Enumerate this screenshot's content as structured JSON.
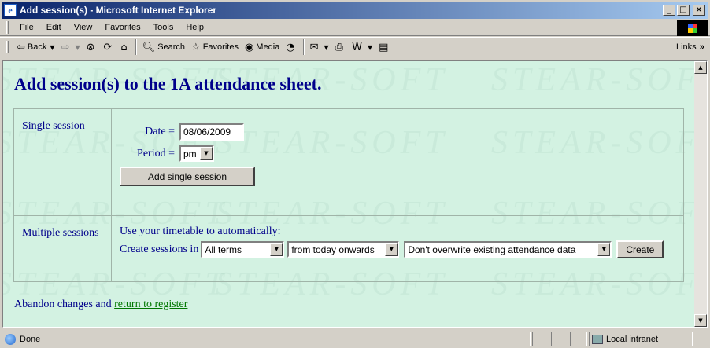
{
  "window": {
    "title": "Add session(s) - Microsoft Internet Explorer",
    "controls": {
      "minimize": "_",
      "maximize": "□",
      "close": "×"
    }
  },
  "menu": {
    "items": [
      {
        "label": "File",
        "accel": "F",
        "rest": "ile"
      },
      {
        "label": "Edit",
        "accel": "E",
        "rest": "dit"
      },
      {
        "label": "View",
        "accel": "V",
        "rest": "iew"
      },
      {
        "label": "Favorites",
        "accel": "F",
        "rest": "avorites",
        "prefix": "F",
        "accel_pos": 0
      },
      {
        "label": "Tools",
        "accel": "T",
        "rest": "ools"
      },
      {
        "label": "Help",
        "accel": "H",
        "rest": "elp"
      }
    ]
  },
  "toolbar": {
    "back_label": "Back",
    "search_label": "Search",
    "favorites_label": "Favorites",
    "media_label": "Media",
    "links_label": "Links",
    "links_chevron": "»"
  },
  "page": {
    "heading": "Add session(s) to the 1A attendance sheet.",
    "watermark_text": "STEAR-SOFT",
    "single": {
      "section_label": "Single session",
      "date_label": "Date =",
      "date_value": "08/06/2009",
      "period_label": "Period =",
      "period_value": "pm",
      "add_button": "Add single session"
    },
    "multiple": {
      "section_label": "Multiple sessions",
      "intro": "Use your timetable to automatically:",
      "create_prefix": "Create sessions in",
      "terms_value": "All terms",
      "range_value": "from today onwards",
      "overwrite_value": "Don't overwrite existing attendance data",
      "create_button": "Create"
    },
    "footer": {
      "prefix": "Abandon changes and",
      "link": "return to register"
    }
  },
  "status": {
    "text": "Done",
    "zone": "Local intranet"
  }
}
